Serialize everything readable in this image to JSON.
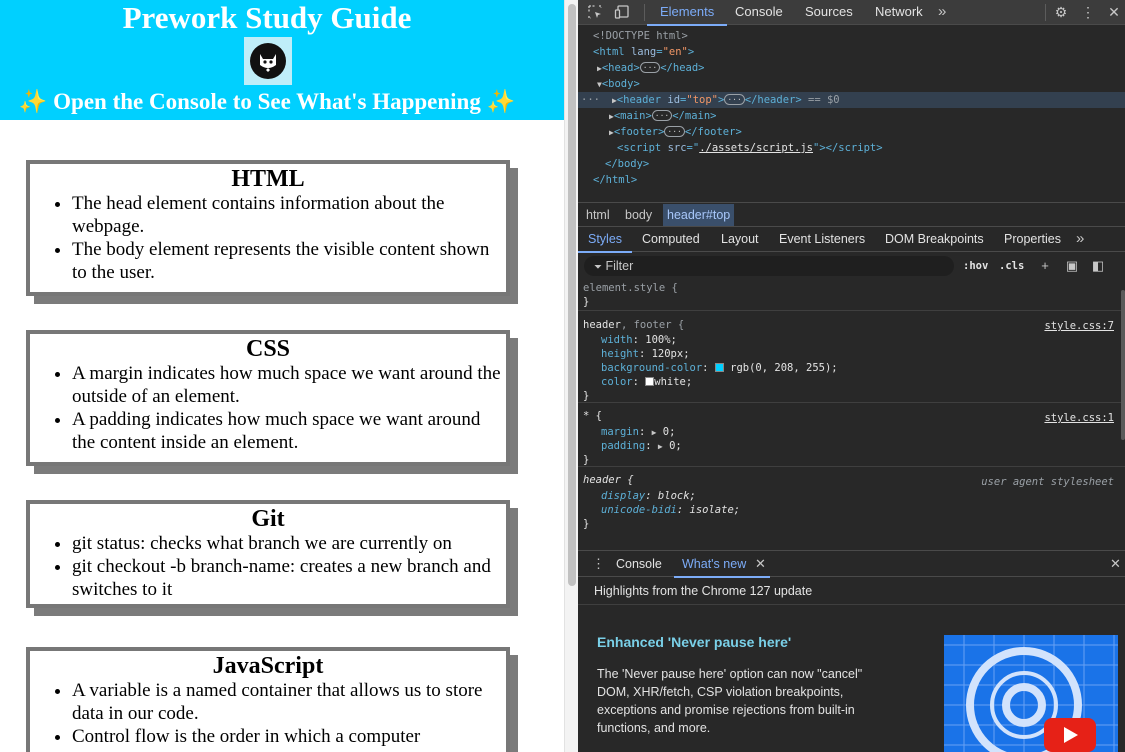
{
  "page": {
    "title": "Prework Study Guide",
    "logo_icon": "cat-face-icon",
    "subtitle": "✨ Open the Console to See What's Happening ✨",
    "sections": [
      {
        "heading": "HTML",
        "items": [
          "The head element contains information about the webpage.",
          "The body element represents the visible content shown to the user."
        ]
      },
      {
        "heading": "CSS",
        "items": [
          "A margin indicates how much space we want around the outside of an element.",
          "A padding indicates how much space we want around the content inside an element."
        ]
      },
      {
        "heading": "Git",
        "items": [
          "git status: checks what branch we are currently on",
          "git checkout -b branch-name: creates a new branch and switches to it"
        ]
      },
      {
        "heading": "JavaScript",
        "items": [
          "A variable is a named container that allows us to store data in our code.",
          "Control flow is the order in which a computer"
        ]
      }
    ],
    "header_color": "#00d0ff"
  },
  "devtools": {
    "tabs": [
      "Elements",
      "Console",
      "Sources",
      "Network"
    ],
    "active_tab": "Elements",
    "more_tabs": "»",
    "dom": {
      "doctype": "<!DOCTYPE html>",
      "html_open": "<html lang=\"en\">",
      "html_close": "</html>",
      "head": "head",
      "body": "body",
      "header_id": "top",
      "sel_marker": "== $0",
      "main": "main",
      "footer": "footer",
      "script_src": "./assets/script.js"
    },
    "breadcrumbs": [
      "html",
      "body",
      "header#top"
    ],
    "subtabs": [
      "Styles",
      "Computed",
      "Layout",
      "Event Listeners",
      "DOM Breakpoints",
      "Properties"
    ],
    "active_subtab": "Styles",
    "filter_placeholder": "Filter",
    "hov": ":hov",
    "cls": ".cls",
    "rules": {
      "element_style": "element.style {",
      "r1_selector": "header",
      "r1_selector_dim": ", footer {",
      "r1_source": "style.css:7",
      "r1_width_p": "width",
      "r1_width_v": "100%;",
      "r1_height_p": "height",
      "r1_height_v": "120px;",
      "r1_bg_p": "background-color",
      "r1_bg_v": "rgb(0, 208, 255);",
      "r1_color_p": "color",
      "r1_color_v": "white;",
      "r2_selector": "* {",
      "r2_source": "style.css:1",
      "r2_margin_p": "margin",
      "r2_margin_v": "0;",
      "r2_padding_p": "padding",
      "r2_padding_v": "0;",
      "r3_selector": "header {",
      "r3_source": "user agent stylesheet",
      "r3_display_p": "display",
      "r3_display_v": "block;",
      "r3_bidi_p": "unicode-bidi",
      "r3_bidi_v": "isolate;",
      "close": "}"
    },
    "drawer": {
      "tabs": [
        "Console",
        "What's new"
      ],
      "active_tab": "What's new",
      "headline": "Highlights from the Chrome 127 update",
      "feature_title": "Enhanced 'Never pause here'",
      "feature_body": "The 'Never pause here' option can now \"cancel\" DOM, XHR/fetch, CSP violation breakpoints, exceptions and promise rejections from built-in functions, and more."
    },
    "accent_color": "#7cacf8"
  }
}
